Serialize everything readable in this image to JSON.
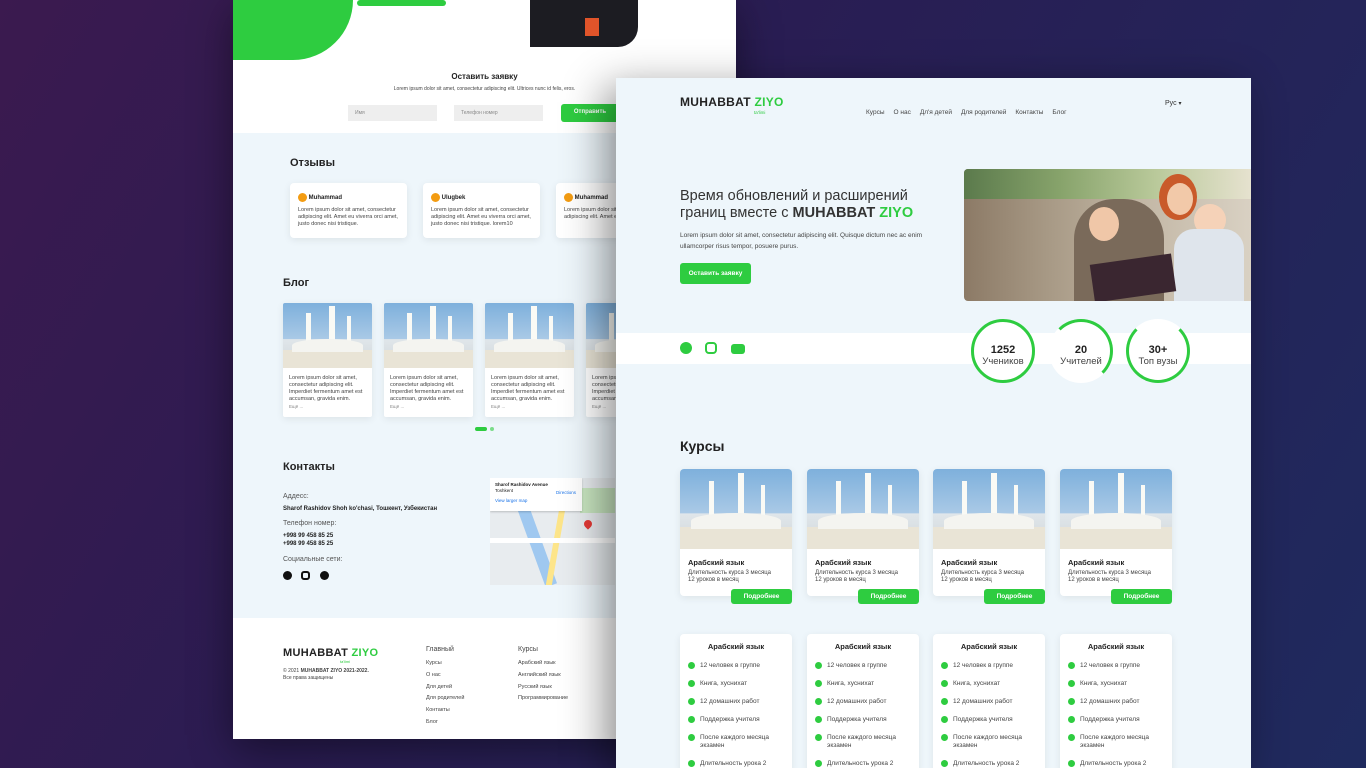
{
  "back": {
    "hero_button": "",
    "form": {
      "title": "Оставить заявку",
      "subtitle": "Lorem ipsum dolor sit amet, consectetur adipiscing elit. Ultrices nunc id felis, eros.",
      "name_placeholder": "Имя",
      "phone_placeholder": "Телефон номер",
      "submit": "Отправить"
    },
    "reviews": {
      "title": "Отзывы",
      "items": [
        {
          "initial": "m",
          "name": "Muhammad",
          "text": "Lorem ipsum dolor sit amet, consectetur adipiscing elit. Amet eu viverra orci amet, justo donec nisi tristique."
        },
        {
          "initial": "u",
          "name": "Ulugbek",
          "text": "Lorem ipsum dolor sit amet, consectetur adipiscing elit. Amet eu viverra orci amet, justo donec nisi tristique. lorem10"
        },
        {
          "initial": "m",
          "name": "Muhammad",
          "text": "Lorem ipsum dolor sit amet, consectetur adipiscing elit. Amet eu viverra orci amet"
        }
      ]
    },
    "blog": {
      "title": "Блог",
      "text": "Lorem ipsum dolor sit amet, consectetur adipiscing elit. Imperdiet fermentum amet est accumsan, gravida enim.",
      "more": "Eщё ..."
    },
    "contacts": {
      "title": "Контакты",
      "address_label": "Аддесс:",
      "address": "Sharof Rashidov Shoh ko'chasi, Тошкент, Узбекистан",
      "phone_label": "Телефон номер:",
      "phone1": "+998 99 458 85 25",
      "phone2": "+998 99 458 85 25",
      "social_label": "Социальные сети:",
      "map_place": "Sharof Rashidov Avenue",
      "map_city": "Toshkent",
      "map_directions": "Directions",
      "map_larger": "View larger map"
    },
    "footer": {
      "logo_a": "MUHABBAT",
      "logo_b": "ZIYO",
      "logo_sub": "ta'limi",
      "copyright_pre": "© 2021",
      "copyright_bold": "MUHABBAT ZIYO 2021-2022.",
      "rights": "Все права защищены",
      "col1_title": "Главный",
      "col1": [
        "Курсы",
        "О нас",
        "Для детей",
        "Для родителей",
        "Контакты",
        "Блог"
      ],
      "col2_title": "Курсы",
      "col2": [
        "Арабский язык",
        "Английский язык",
        "Русский язык",
        "Программирование"
      ]
    }
  },
  "front": {
    "logo_a": "MUHABBAT",
    "logo_b": "ZIYO",
    "logo_sub": "ta'limi",
    "nav": [
      "Курсы",
      "О нас",
      "Дл'я детей",
      "Для родителей",
      "Контакты",
      "Блог"
    ],
    "lang": "Рус",
    "hero": {
      "title_line1": "Время обновлений и расширений",
      "title_line2_pre": "границ вместе с",
      "title_brand_a": "MUHABBAT",
      "title_brand_b": "ZIYO",
      "text": "Lorem ipsum dolor sit amet, consectetur adipiscing elit. Quisque dictum nec ac enim ullamcorper risus tempor, posuere purus.",
      "button": "Оставить заявку"
    },
    "stats": [
      {
        "value": "1252",
        "label": "Учеников"
      },
      {
        "value": "20",
        "label": "Учителей"
      },
      {
        "value": "30+",
        "label": "Топ вузы"
      }
    ],
    "courses": {
      "title": "Курсы",
      "item_title": "Арабский язык",
      "item_text": "Длительность курса 3 месяца 12 уроков в месяц",
      "more": "Подробнее"
    },
    "plans": {
      "title": "Арабский язык",
      "features": [
        "12 человек в группе",
        "Книга, хусниxат",
        "12 домашних работ",
        "Поддержка учителя",
        "После каждого месяца экзамен",
        "Длительность урока 2"
      ]
    }
  }
}
